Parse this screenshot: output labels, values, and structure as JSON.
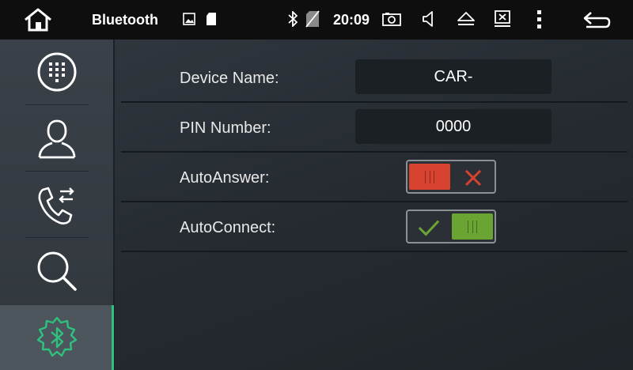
{
  "statusbar": {
    "title": "Bluetooth",
    "time": "20:09",
    "icons": [
      "home-icon",
      "image-icon",
      "sd-card-icon",
      "bluetooth-icon",
      "no-sim-icon",
      "camera-icon",
      "volume-icon",
      "eject-icon",
      "close-window-icon",
      "more-icon",
      "back-icon"
    ]
  },
  "sidebar": {
    "items": [
      "dialpad-icon",
      "contacts-icon",
      "call-log-icon",
      "search-icon",
      "bluetooth-settings-icon"
    ],
    "active_index": 4
  },
  "settings": {
    "device_name_label": "Device Name:",
    "device_name_value": "CAR-",
    "pin_label": "PIN Number:",
    "pin_value": "0000",
    "auto_answer_label": "AutoAnswer:",
    "auto_answer_on": false,
    "auto_connect_label": "AutoConnect:",
    "auto_connect_on": true
  },
  "colors": {
    "accent_green": "#2ec27e",
    "toggle_off_red": "#d8432f",
    "toggle_on_green": "#6aa534"
  }
}
